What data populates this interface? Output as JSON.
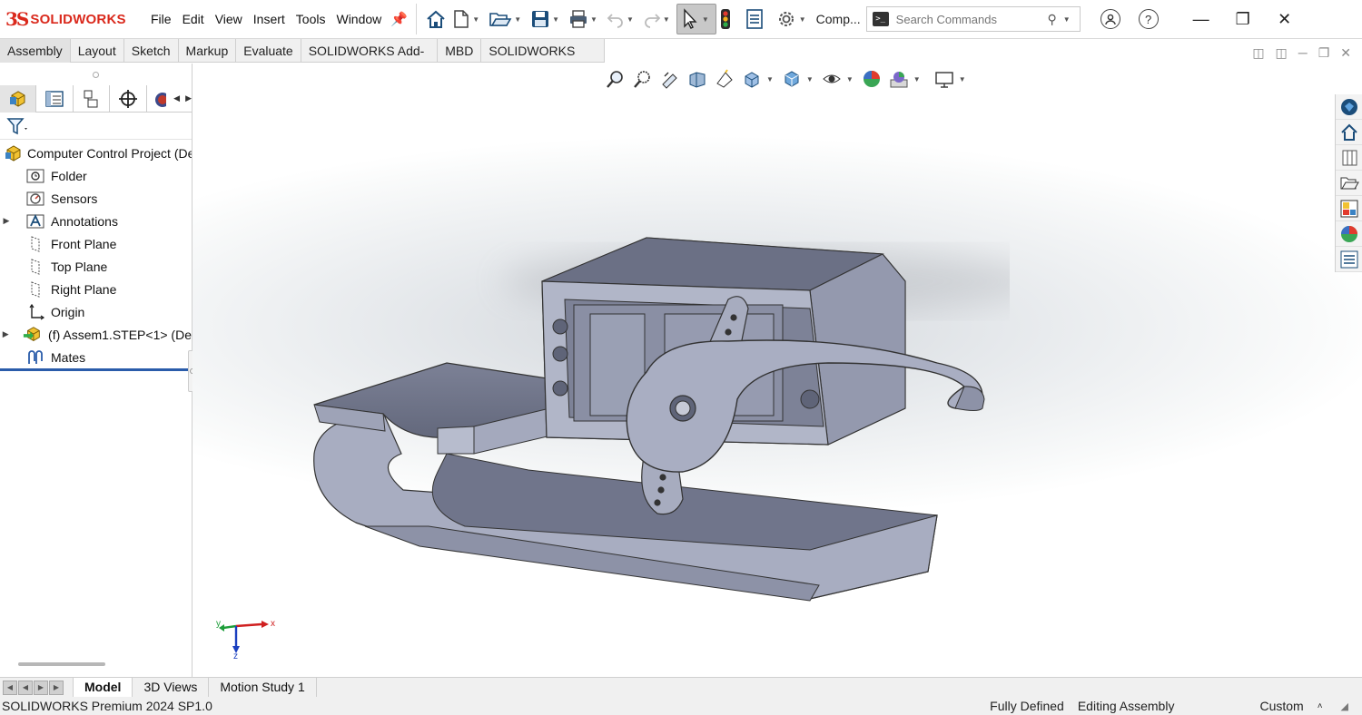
{
  "app": {
    "brand": "SOLIDWORKS",
    "brand_mark": "3S"
  },
  "menu": [
    "File",
    "Edit",
    "View",
    "Insert",
    "Tools",
    "Window"
  ],
  "toolbar": {
    "config_label": "Comp...",
    "search_placeholder": "Search Commands",
    "help": "?"
  },
  "command_tabs": [
    {
      "label": "Assembly",
      "selected": true
    },
    {
      "label": "Layout"
    },
    {
      "label": "Sketch"
    },
    {
      "label": "Markup"
    },
    {
      "label": "Evaluate"
    },
    {
      "label": "SOLIDWORKS Add-Ins"
    },
    {
      "label": "MBD"
    },
    {
      "label": "SOLIDWORKS CAM"
    }
  ],
  "tree": {
    "root": "Computer Control Project (De",
    "items": [
      {
        "label": "Folder",
        "icon": "folder-icon"
      },
      {
        "label": "Sensors",
        "icon": "sensors-icon"
      },
      {
        "label": "Annotations",
        "icon": "annotations-icon",
        "expandable": true
      },
      {
        "label": "Front Plane",
        "icon": "plane-icon"
      },
      {
        "label": "Top Plane",
        "icon": "plane-icon"
      },
      {
        "label": "Right Plane",
        "icon": "plane-icon"
      },
      {
        "label": "Origin",
        "icon": "origin-icon"
      },
      {
        "label": "(f) Assem1.STEP<1> (De",
        "icon": "subassembly-icon",
        "expandable": true
      },
      {
        "label": "Mates",
        "icon": "mates-icon"
      }
    ]
  },
  "triad": {
    "x": "x",
    "y": "y",
    "z": "z"
  },
  "bottom_tabs": [
    {
      "label": "Model",
      "selected": true
    },
    {
      "label": "3D Views"
    },
    {
      "label": "Motion Study 1"
    }
  ],
  "status": {
    "product": "SOLIDWORKS Premium 2024 SP1.0",
    "definition": "Fully Defined",
    "mode": "Editing Assembly",
    "units": "Custom",
    "units_caret": "˄"
  },
  "colors": {
    "brand": "#da291c",
    "model": "#9aa0b4",
    "rollback": "#2a5caa"
  }
}
